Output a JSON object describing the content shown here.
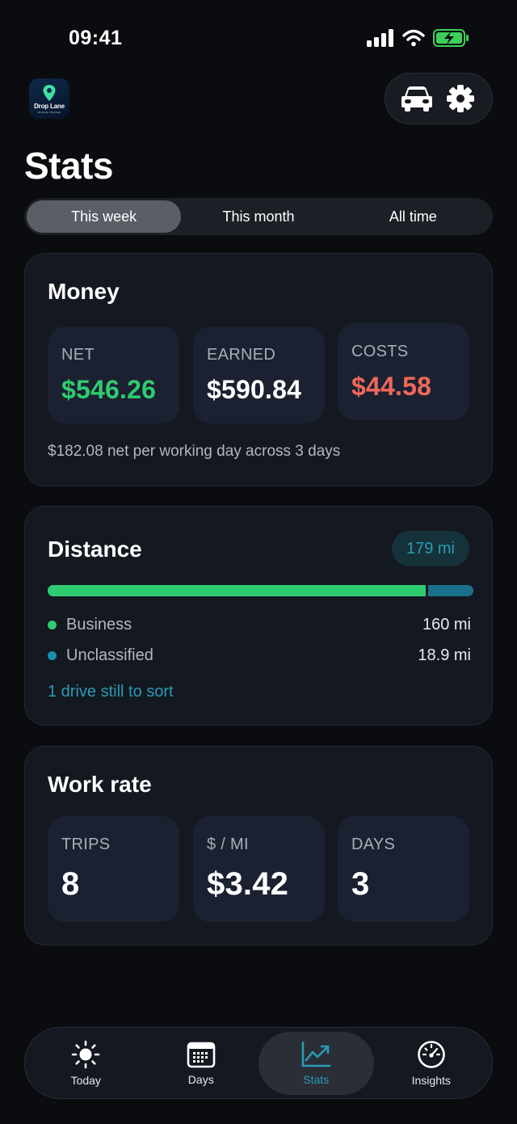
{
  "status_bar": {
    "time": "09:41"
  },
  "app": {
    "logo_text": "Drop Lane",
    "logo_sub": "MILEAGE TRACKER"
  },
  "header": {
    "title": "Stats",
    "car_icon": "car-icon",
    "settings_icon": "gear-icon"
  },
  "segments": [
    {
      "label": "This week",
      "active": true
    },
    {
      "label": "This month",
      "active": false
    },
    {
      "label": "All time",
      "active": false
    }
  ],
  "money": {
    "title": "Money",
    "tiles": [
      {
        "label": "NET",
        "value": "$546.26",
        "color": "#2ecc71"
      },
      {
        "label": "EARNED",
        "value": "$590.84",
        "color": "#ffffff"
      },
      {
        "label": "COSTS",
        "value": "$44.58",
        "color": "#f0685a"
      }
    ],
    "footnote": "$182.08 net per working day across 3 days"
  },
  "distance": {
    "title": "Distance",
    "total": "179 mi",
    "business_fraction": 0.894,
    "rows": [
      {
        "label": "Business",
        "value": "160 mi",
        "color": "#2ecc71"
      },
      {
        "label": "Unclassified",
        "value": "18.9 mi",
        "color": "#1a8fb0"
      }
    ],
    "link": "1 drive still to sort"
  },
  "work_rate": {
    "title": "Work rate",
    "tiles": [
      {
        "label": "TRIPS",
        "value": "8"
      },
      {
        "label": "$ / MI",
        "value": "$3.42"
      },
      {
        "label": "DAYS",
        "value": "3"
      }
    ]
  },
  "tabs": [
    {
      "label": "Today",
      "icon": "sun-icon",
      "active": false
    },
    {
      "label": "Days",
      "icon": "calendar-icon",
      "active": false
    },
    {
      "label": "Stats",
      "icon": "chart-icon",
      "active": true
    },
    {
      "label": "Insights",
      "icon": "speedometer-icon",
      "active": false
    }
  ],
  "colors": {
    "accent": "#2a9bb3",
    "positive": "#2ecc71",
    "negative": "#f0685a"
  }
}
